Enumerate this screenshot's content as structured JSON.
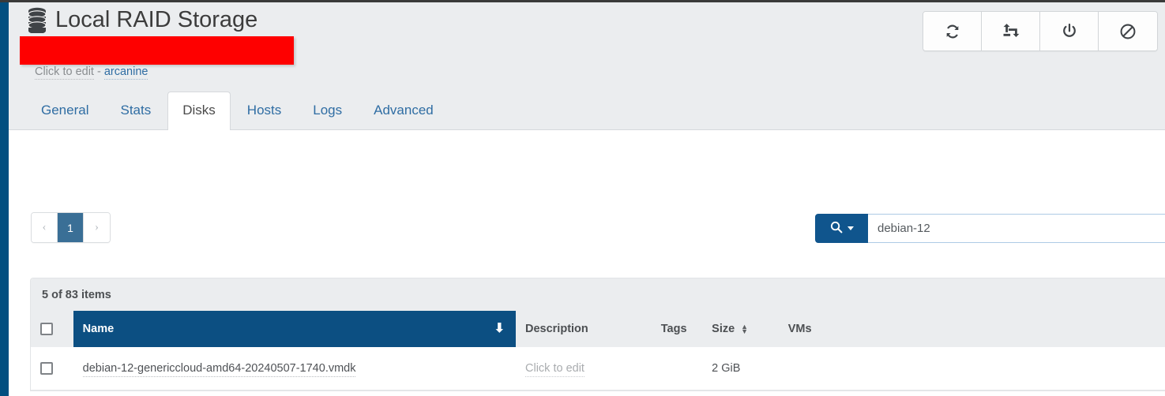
{
  "header": {
    "title": "Local RAID Storage",
    "title_icon": "database-stack-icon",
    "subtitle_prefix": "Click to edit",
    "subtitle_separator": " - ",
    "subtitle_host": "arcanine",
    "redaction_color": "#fe0000"
  },
  "actions": [
    {
      "name": "refresh-button",
      "icon": "refresh-icon",
      "title": "Refresh"
    },
    {
      "name": "transfer-button",
      "icon": "retweet-icon",
      "title": "Transfer"
    },
    {
      "name": "power-button",
      "icon": "power-icon",
      "title": "Power"
    },
    {
      "name": "disable-button",
      "icon": "ban-icon",
      "title": "Disable"
    }
  ],
  "tabs": [
    {
      "label": "General",
      "active": false
    },
    {
      "label": "Stats",
      "active": false
    },
    {
      "label": "Disks",
      "active": true
    },
    {
      "label": "Hosts",
      "active": false
    },
    {
      "label": "Logs",
      "active": false
    },
    {
      "label": "Advanced",
      "active": false
    }
  ],
  "pagination": {
    "prev_label": "‹",
    "next_label": "›",
    "pages": [
      "1"
    ],
    "current_page": "1"
  },
  "search": {
    "value": "debian-12",
    "placeholder": "",
    "icon": "magnifier-icon",
    "button_color": "#10558d"
  },
  "table": {
    "summary": "5 of 83 items",
    "sort_column": "Name",
    "sort_direction": "down",
    "sorted_header_color": "#0c4f82",
    "select_all_checked": false,
    "columns": [
      {
        "key": "check",
        "label": "",
        "sortable": false
      },
      {
        "key": "name",
        "label": "Name",
        "sortable": true
      },
      {
        "key": "desc",
        "label": "Description",
        "sortable": false
      },
      {
        "key": "tags",
        "label": "Tags",
        "sortable": false
      },
      {
        "key": "size",
        "label": "Size",
        "sortable": true
      },
      {
        "key": "vms",
        "label": "VMs",
        "sortable": false
      }
    ],
    "rows": [
      {
        "checked": false,
        "name": "debian-12-genericcloud-amd64-20240507-1740.vmdk",
        "description": "Click to edit",
        "description_is_placeholder": true,
        "tags": "",
        "size": "2 GiB",
        "vms": ""
      }
    ]
  }
}
